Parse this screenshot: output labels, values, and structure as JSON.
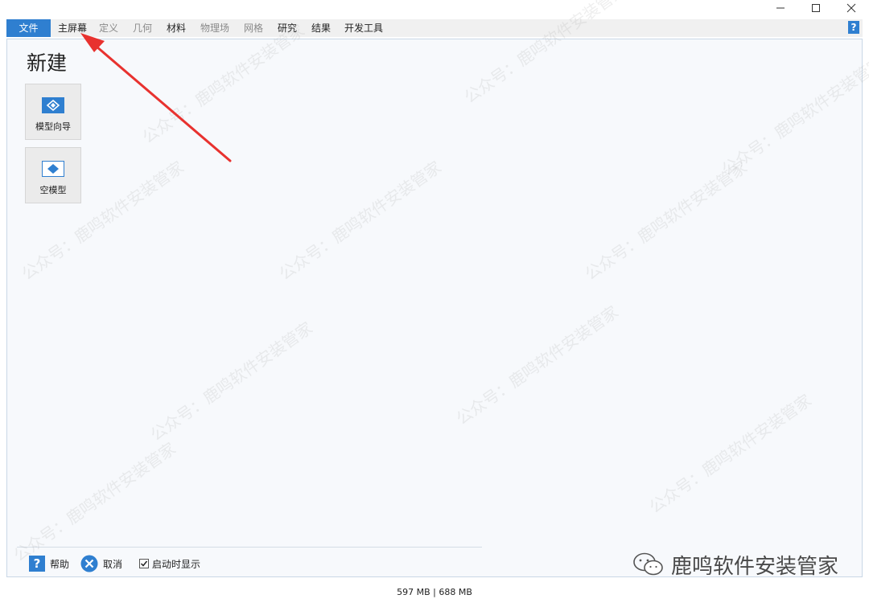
{
  "menu": {
    "file": "文件",
    "tabs": [
      {
        "label": "主屏幕",
        "enabled": true
      },
      {
        "label": "定义",
        "enabled": false
      },
      {
        "label": "几何",
        "enabled": false
      },
      {
        "label": "材料",
        "enabled": true
      },
      {
        "label": "物理场",
        "enabled": false
      },
      {
        "label": "网格",
        "enabled": false
      },
      {
        "label": "研究",
        "enabled": true
      },
      {
        "label": "结果",
        "enabled": true
      },
      {
        "label": "开发工具",
        "enabled": true
      }
    ],
    "help": "?"
  },
  "panel": {
    "title": "新建",
    "tiles": [
      {
        "label": "模型向导",
        "icon": "model-wizard-icon"
      },
      {
        "label": "空模型",
        "icon": "blank-model-icon"
      }
    ]
  },
  "footer": {
    "help_label": "帮助",
    "cancel_label": "取消",
    "show_on_startup_label": "启动时显示",
    "show_on_startup_checked": true
  },
  "status": {
    "memory": "597 MB | 688 MB"
  },
  "watermark": {
    "text": "公众号：鹿鸣软件安装管家",
    "brand": "鹿鸣软件安装管家"
  },
  "colors": {
    "accent": "#2f7fd0",
    "arrow": "#e8322f",
    "panel_bg": "#f7f9fc"
  }
}
